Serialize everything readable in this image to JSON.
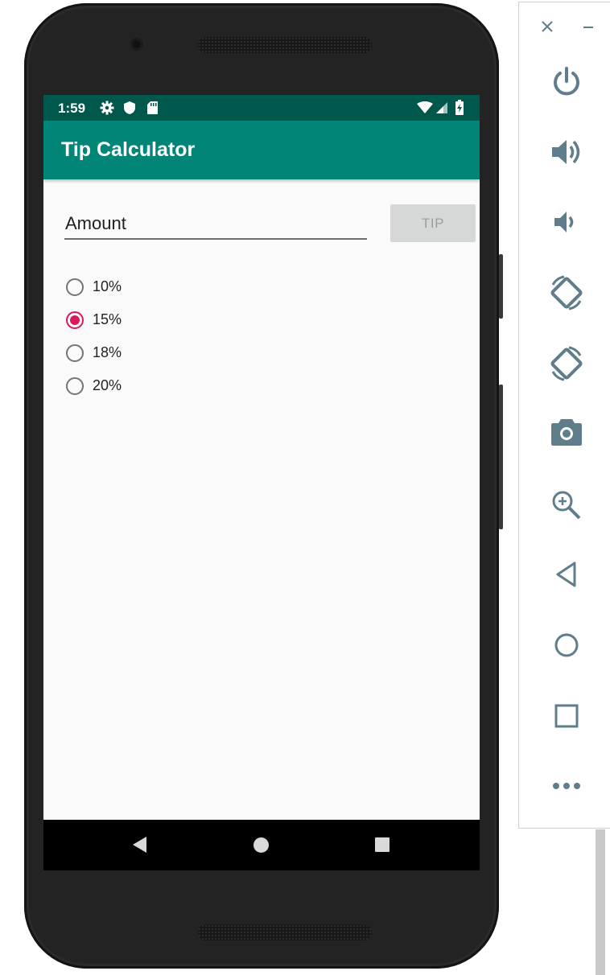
{
  "status_bar": {
    "time": "1:59",
    "icons": [
      "settings-gear-icon",
      "shield-icon",
      "sd-card-icon",
      "wifi-icon",
      "signal-icon",
      "battery-charging-icon"
    ]
  },
  "app_bar": {
    "title": "Tip Calculator",
    "color": "#008577",
    "status_color": "#00574b"
  },
  "form": {
    "amount_placeholder": "Amount",
    "amount_value": "",
    "tip_button_label": "TIP",
    "tip_button_enabled": false
  },
  "tip_options": [
    {
      "label": "10%",
      "checked": false
    },
    {
      "label": "15%",
      "checked": true
    },
    {
      "label": "18%",
      "checked": false
    },
    {
      "label": "20%",
      "checked": false
    }
  ],
  "accent_color": "#d81b60",
  "nav_bar": [
    "back-icon",
    "home-icon",
    "recents-icon"
  ],
  "emulator_toolbar": [
    "close-icon",
    "minimize-icon",
    "power-icon",
    "volume-up-icon",
    "volume-down-icon",
    "rotate-left-icon",
    "rotate-right-icon",
    "screenshot-camera-icon",
    "zoom-icon",
    "back-icon",
    "home-icon",
    "overview-icon",
    "more-icon"
  ]
}
